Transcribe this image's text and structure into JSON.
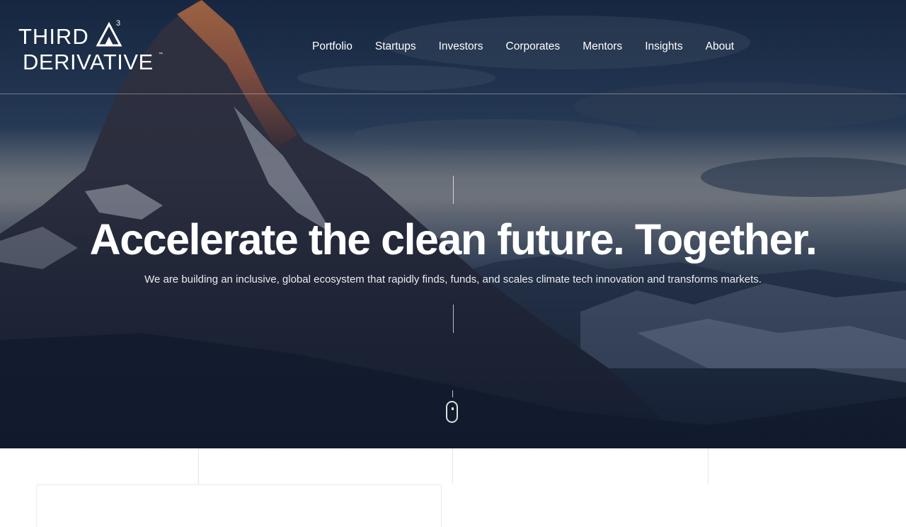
{
  "logo": {
    "line1": "THIRD",
    "line2": "DERIVATIVE",
    "superscript": "3",
    "trademark": "™"
  },
  "nav": {
    "items": [
      {
        "label": "Portfolio"
      },
      {
        "label": "Startups"
      },
      {
        "label": "Investors"
      },
      {
        "label": "Corporates"
      },
      {
        "label": "Mentors"
      },
      {
        "label": "Insights"
      },
      {
        "label": "About"
      }
    ]
  },
  "hero": {
    "title": "Accelerate the clean future. Together.",
    "subtitle": "We are building an inclusive, global ecosystem that rapidly finds, funds, and scales climate tech innovation and transforms markets.",
    "scroll_icon": "mouse-scroll-icon"
  },
  "colors": {
    "text_on_dark": "#ffffff",
    "sky_dark": "#1b2d49",
    "divider": "#e6e6e6"
  }
}
